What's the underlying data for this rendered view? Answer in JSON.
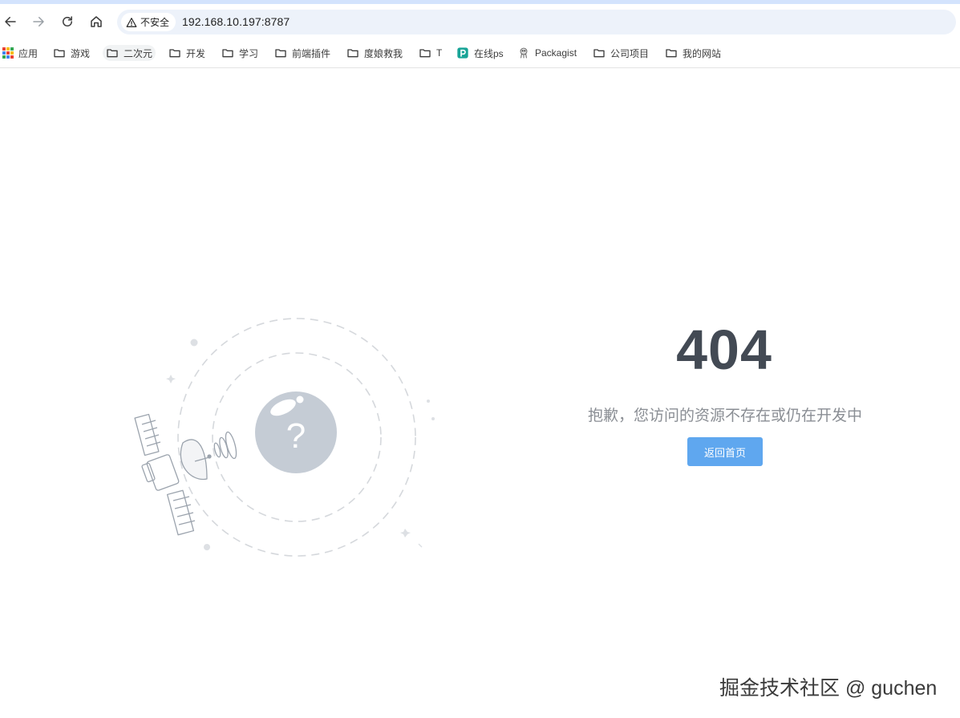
{
  "browser": {
    "security_label": "不安全",
    "url": "192.168.10.197:8787",
    "nav": {
      "back_icon": "arrow-left-icon",
      "forward_icon": "arrow-right-icon",
      "reload_icon": "reload-icon",
      "home_icon": "home-icon"
    }
  },
  "bookmarks": [
    {
      "label": "应用",
      "icon": "apps-grid-icon"
    },
    {
      "label": "游戏",
      "icon": "folder-icon"
    },
    {
      "label": "二次元",
      "icon": "folder-icon"
    },
    {
      "label": "开发",
      "icon": "folder-icon"
    },
    {
      "label": "学习",
      "icon": "folder-icon"
    },
    {
      "label": "前端插件",
      "icon": "folder-icon"
    },
    {
      "label": "度娘救我",
      "icon": "folder-icon"
    },
    {
      "label": "T",
      "icon": "folder-icon"
    },
    {
      "label": "在线ps",
      "icon": "photopea-icon"
    },
    {
      "label": "Packagist",
      "icon": "packagist-icon"
    },
    {
      "label": "公司项目",
      "icon": "folder-icon"
    },
    {
      "label": "我的网站",
      "icon": "folder-icon"
    }
  ],
  "error_page": {
    "code": "404",
    "message": "抱歉，您访问的资源不存在或仍在开发中",
    "home_button": "返回首页",
    "illustration_icon": "satellite-question-icon"
  },
  "watermark": "掘金技术社区 @ guchen",
  "colors": {
    "accent": "#5fa7ef",
    "heading": "#434a54",
    "message": "#8a8e94",
    "omnibox": "#edf2fa"
  }
}
